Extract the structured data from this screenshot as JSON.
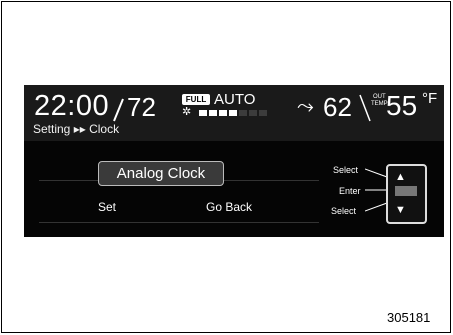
{
  "status_bar": {
    "time": "22:00",
    "temp_left": "72",
    "full_badge": "FULL",
    "mode": "AUTO",
    "temp_right": "62",
    "out_label_line1": "OUT",
    "out_label_line2": "TEMP",
    "outside_temp": "55",
    "temp_unit": "°F",
    "fan_level": 0.45
  },
  "breadcrumb": "Setting ▸▸ Clock",
  "menu": {
    "selected_item": "Analog Clock",
    "set_label": "Set",
    "back_label": "Go Back"
  },
  "controls": {
    "select_up_label": "Select",
    "enter_label": "Enter",
    "select_down_label": "Select"
  },
  "caption": "305181"
}
